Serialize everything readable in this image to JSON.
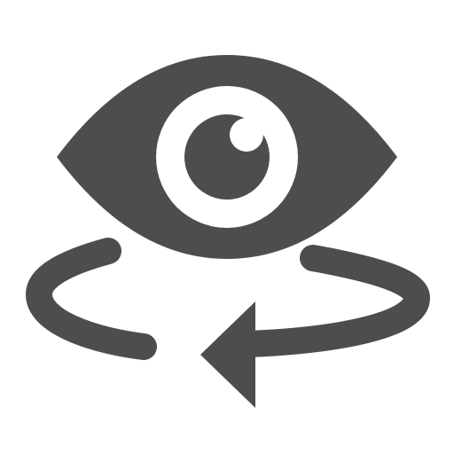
{
  "icon": {
    "name": "eye-rotate-icon",
    "parts": [
      "eye-icon",
      "rotation-arrow-icon"
    ],
    "colors": {
      "foreground": "#4d4d4d",
      "background": "#ffffff"
    }
  }
}
